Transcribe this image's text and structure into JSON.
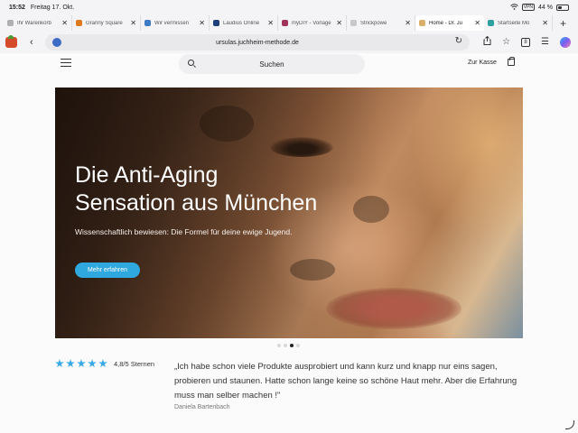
{
  "status_bar": {
    "time": "15:52",
    "date": "Freitag 17. Okt.",
    "vpn": "VPN",
    "battery_percent": 44,
    "battery_label": "44 %"
  },
  "tabs": [
    {
      "label": "Ihr Warenkorb",
      "favicon_color": "#b0b0b0",
      "active": false
    },
    {
      "label": "Granny Square",
      "favicon_color": "#e07a1e",
      "active": false
    },
    {
      "label": "Wir vermissen",
      "favicon_color": "#3d7ac6",
      "active": false
    },
    {
      "label": "Laudius Online",
      "favicon_color": "#1d3f7a",
      "active": false
    },
    {
      "label": "myDIY - Vorlage",
      "favicon_color": "#a0335a",
      "active": false
    },
    {
      "label": "Strickpowe",
      "favicon_color": "#c8c8c8",
      "active": false
    },
    {
      "label": "Home - Dr. Ju",
      "favicon_color": "#d8b06a",
      "active": true
    },
    {
      "label": "Startseite Mo",
      "favicon_color": "#2ea0a0",
      "active": false
    }
  ],
  "toolbar": {
    "url": "ursulas.juchheim-methode.de",
    "tab_count": "8"
  },
  "site_header": {
    "search_label": "Suchen",
    "cart_label": "Zur Kasse"
  },
  "hero": {
    "title_line1": "Die Anti-Aging",
    "title_line2": "Sensation aus München",
    "subtitle": "Wissenschaftlich bewiesen: Die Formel für deine ewige Jugend.",
    "button_label": "Mehr erfahren",
    "slide_count": 4,
    "active_slide": 3
  },
  "review": {
    "stars": 5,
    "rating_text": "4,8/5 Sternen",
    "quote": "„Ich habe schon viele Produkte ausprobiert und kann kurz und knapp nur eins sagen, probieren und staunen. Hatte schon lange keine so schöne Haut mehr. Aber die Erfahrung muss man selber machen !\"",
    "author": "Daniela Bartenbach"
  },
  "colors": {
    "accent": "#2fa8e0",
    "star": "#3aa8e6"
  }
}
